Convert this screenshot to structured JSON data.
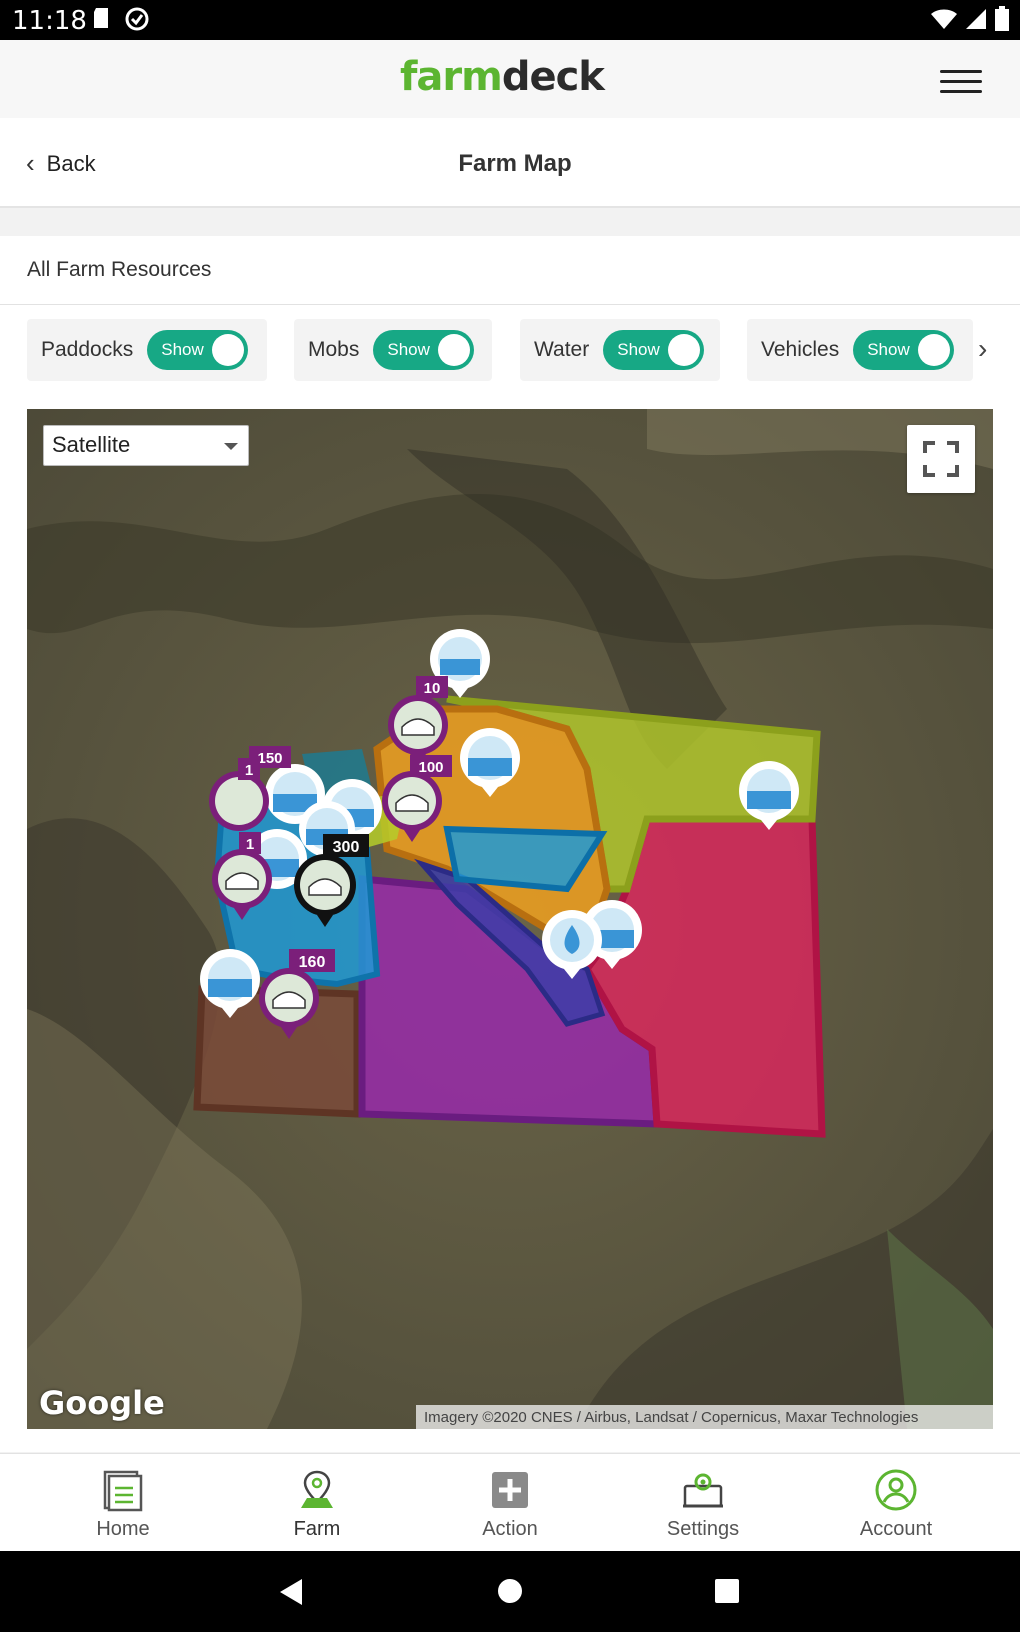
{
  "status_bar": {
    "time": "11:18"
  },
  "header": {
    "logo_part1": "farm",
    "logo_part2": "deck"
  },
  "subheader": {
    "back_label": "Back",
    "title": "Farm Map"
  },
  "card": {
    "title": "All Farm Resources"
  },
  "filters": [
    {
      "label": "Paddocks",
      "toggle": "Show"
    },
    {
      "label": "Mobs",
      "toggle": "Show"
    },
    {
      "label": "Water",
      "toggle": "Show"
    },
    {
      "label": "Vehicles",
      "toggle": "Show"
    }
  ],
  "map": {
    "type_selected": "Satellite",
    "google_logo": "Google",
    "attribution": "Imagery ©2020 CNES / Airbus, Landsat / Copernicus, Maxar Technologies",
    "mob_counts": [
      "10",
      "100",
      "150",
      "1",
      "1",
      "300",
      "160"
    ]
  },
  "bottom_nav": [
    {
      "label": "Home"
    },
    {
      "label": "Farm"
    },
    {
      "label": "Action"
    },
    {
      "label": "Settings"
    },
    {
      "label": "Account"
    }
  ],
  "colors": {
    "brand_green": "#5cb531",
    "toggle_teal": "#17a885",
    "paddock_purple": "#9b27b0",
    "paddock_pink": "#e0245e",
    "paddock_lime": "#b5cc2a",
    "paddock_orange": "#f0a020",
    "paddock_brown": "#7a4a38",
    "paddock_blue": "#1e9ad6",
    "mob_marker": "#7b1f7a"
  }
}
